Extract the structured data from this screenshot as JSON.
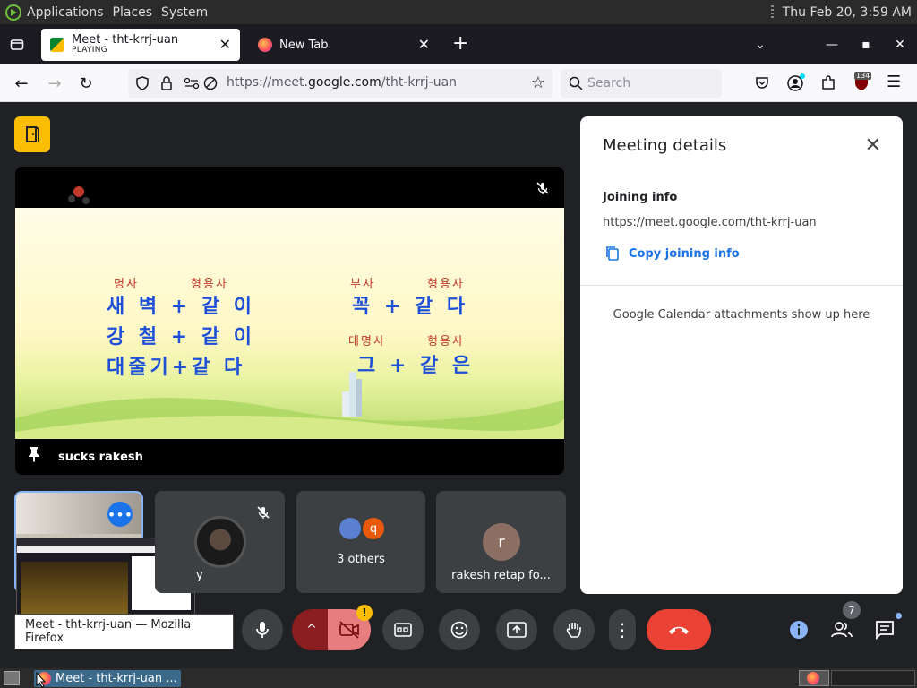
{
  "system": {
    "menus": [
      "Applications",
      "Places",
      "System"
    ],
    "clock": "Thu Feb 20,  3:59 AM"
  },
  "tabs": [
    {
      "title": "Meet - tht-krrj-uan",
      "status": "PLAYING",
      "active": true
    },
    {
      "title": "New Tab",
      "active": false
    }
  ],
  "navbar": {
    "url_prefix": "https://meet.",
    "url_domain": "google.com",
    "url_path": "/tht-krrj-uan",
    "search_placeholder": "Search",
    "extension_badge": "134"
  },
  "main_video": {
    "participant": "sucks rakesh",
    "slide": {
      "left_headers": [
        "명사",
        "형용사"
      ],
      "left_lines": [
        "새 벽 + 같 이",
        "강 철 + 같 이",
        "대줄기+같 다"
      ],
      "right_headers_1": [
        "부사",
        "형용사"
      ],
      "right_line_1": "꼭  + 같 다",
      "right_headers_2": [
        "대명사",
        "형용사"
      ],
      "right_line_2": "그  + 같 은"
    }
  },
  "tiles": [
    {
      "label": "y"
    },
    {
      "label": "3 others",
      "avatar_letter": "q"
    },
    {
      "label": "rakesh retap fo...",
      "avatar_letter": "r"
    }
  ],
  "panel": {
    "title": "Meeting details",
    "joining_heading": "Joining info",
    "link": "https://meet.google.com/tht-krrj-uan",
    "copy_label": "Copy joining info",
    "calendar_text": "Google Calendar attachments show up here"
  },
  "controls": {
    "participant_count": "7",
    "warning": "!"
  },
  "tooltip": "Meet - tht-krrj-uan — Mozilla Firefox",
  "taskbar": {
    "item": "Meet - tht-krrj-uan ..."
  },
  "colors": {
    "accent": "#1a73e8",
    "end_call": "#ea4335",
    "warning": "#fbbc04",
    "meet_bg": "#202124"
  }
}
